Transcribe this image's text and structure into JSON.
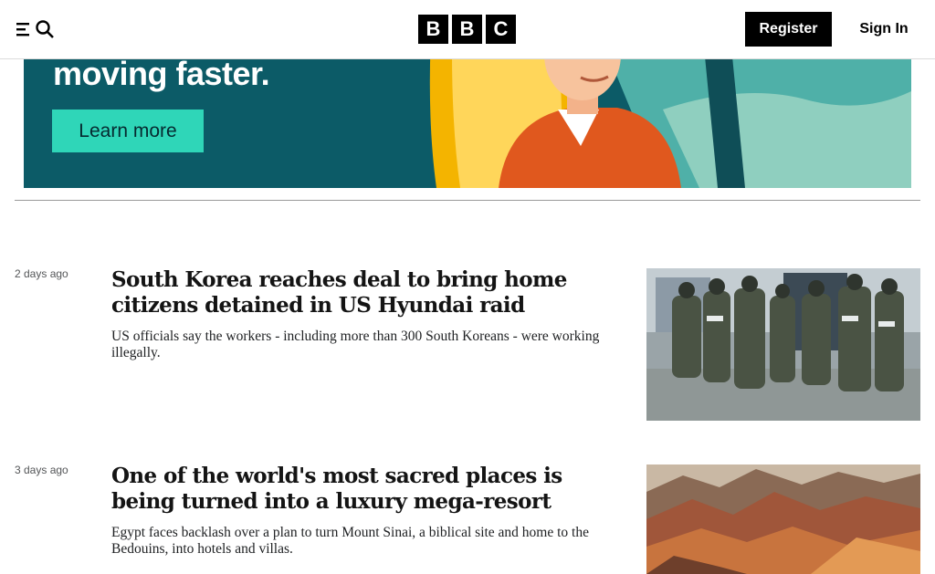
{
  "header": {
    "logo_letters": [
      "B",
      "B",
      "C"
    ],
    "register_label": "Register",
    "signin_label": "Sign In"
  },
  "ad": {
    "headline": "moving faster.",
    "cta_label": "Learn more",
    "colors": {
      "background": "#0d5f6b",
      "cta": "#2fd6b8"
    }
  },
  "stories": [
    {
      "time": "2 days ago",
      "title": "South Korea reaches deal to bring home citizens detained in US Hyundai raid",
      "summary": "US officials say the workers - including more than 300 South Koreans - were working illegally.",
      "image_alt": "Armed agents in tactical gear outside a building"
    },
    {
      "time": "3 days ago",
      "title": "One of the world's most sacred places is being turned into a luxury mega-resort",
      "summary": "Egypt faces backlash over a plan to turn Mount Sinai, a biblical site and home to the Bedouins, into hotels and villas.",
      "image_alt": "Rugged mountain peaks of Mount Sinai"
    }
  ]
}
